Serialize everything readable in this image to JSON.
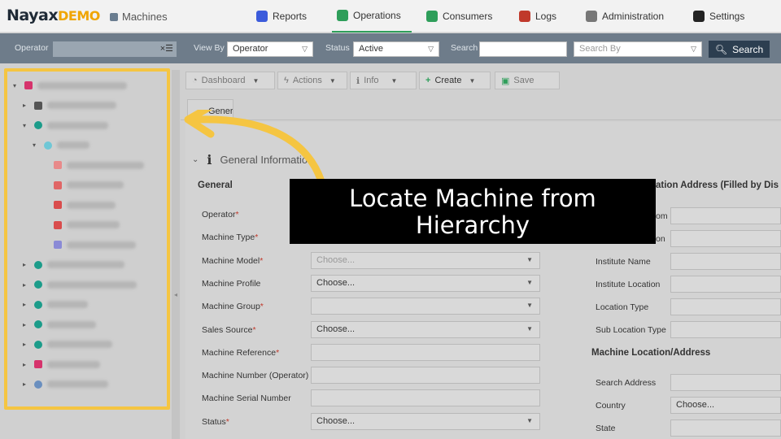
{
  "header": {
    "logo": {
      "brand": "Nayax",
      "suffix": "DEMO"
    },
    "module_title": "Machines",
    "nav": [
      {
        "label": "Reports",
        "icon": "chart-icon",
        "color": "#3b5bdb"
      },
      {
        "label": "Operations",
        "icon": "operations-icon",
        "color": "#2e9e5a",
        "active": true
      },
      {
        "label": "Consumers",
        "icon": "consumers-icon",
        "color": "#2e9e5a"
      },
      {
        "label": "Logs",
        "icon": "logs-icon",
        "color": "#c0392b"
      },
      {
        "label": "Administration",
        "icon": "administration-icon",
        "color": "#777777"
      },
      {
        "label": "Settings",
        "icon": "settings-icon",
        "color": "#222222"
      }
    ]
  },
  "filters": {
    "operator_label": "Operator",
    "view_by_label": "View By",
    "view_by_value": "Operator",
    "status_label": "Status",
    "status_value": "Active",
    "search_label": "Search",
    "search_value": "",
    "search_by_placeholder": "Search By",
    "search_button": "Search"
  },
  "toolbar": {
    "dashboard": "Dashboard",
    "actions": "Actions",
    "info": "Info",
    "create": "Create",
    "save": "Save"
  },
  "tabs": {
    "general": "General"
  },
  "section": {
    "title": "General Information"
  },
  "general": {
    "title": "General",
    "fields": [
      {
        "label": "Operator",
        "required": true,
        "value": ""
      },
      {
        "label": "Machine Type",
        "required": true,
        "value": ""
      },
      {
        "label": "Machine Model",
        "required": true,
        "value": "Choose...",
        "select": true,
        "placeholder": true
      },
      {
        "label": "Machine Profile",
        "required": false,
        "value": "Choose...",
        "select": true
      },
      {
        "label": "Machine Group",
        "required": true,
        "value": "",
        "select": true
      },
      {
        "label": "Sales Source",
        "required": true,
        "value": "Choose...",
        "select": true
      },
      {
        "label": "Machine Reference",
        "required": true,
        "value": ""
      },
      {
        "label": "Machine Number (Operator)",
        "required": false,
        "value": ""
      },
      {
        "label": "Machine Serial Number",
        "required": false,
        "value": ""
      },
      {
        "label": "Status",
        "required": true,
        "value": "Choose...",
        "select": true
      }
    ]
  },
  "location": {
    "title_partial": "ation Address (Filled by Dis",
    "fields_partial": [
      "om",
      "on"
    ],
    "fields": [
      "Institute Name",
      "Institute Location",
      "Location Type",
      "Sub Location Type"
    ],
    "address_title": "Machine Location/Address",
    "address_fields": [
      {
        "label": "Search Address",
        "value": ""
      },
      {
        "label": "Country",
        "value": "Choose..."
      },
      {
        "label": "State",
        "value": ""
      }
    ]
  },
  "tree": {
    "nodes": [
      {
        "indent": 0,
        "arrow": "▾",
        "icon": "hierarchy-icon",
        "color": "#d6336c",
        "w": 110
      },
      {
        "indent": 1,
        "arrow": "▸",
        "icon": "folder-icon",
        "color": "#555555",
        "w": 85
      },
      {
        "indent": 1,
        "arrow": "▾",
        "icon": "operator-icon",
        "color": "#1c9c8a",
        "w": 75
      },
      {
        "indent": 2,
        "arrow": "▾",
        "icon": "location-icon",
        "color": "#6fc7d6",
        "w": 40
      },
      {
        "indent": 3,
        "arrow": "",
        "icon": "machine-icon",
        "color": "#e88a8a",
        "w": 95
      },
      {
        "indent": 3,
        "arrow": "",
        "icon": "machine-icon",
        "color": "#e06666",
        "w": 70
      },
      {
        "indent": 3,
        "arrow": "",
        "icon": "machine-icon",
        "color": "#d94c4c",
        "w": 60
      },
      {
        "indent": 3,
        "arrow": "",
        "icon": "machine-icon",
        "color": "#d94c4c",
        "w": 65
      },
      {
        "indent": 3,
        "arrow": "",
        "icon": "machine-icon",
        "color": "#8a8ad6",
        "w": 85
      },
      {
        "indent": 1,
        "arrow": "▸",
        "icon": "operator-icon",
        "color": "#1c9c8a",
        "w": 95
      },
      {
        "indent": 1,
        "arrow": "▸",
        "icon": "operator-icon",
        "color": "#1c9c8a",
        "w": 110
      },
      {
        "indent": 1,
        "arrow": "▸",
        "icon": "operator-icon",
        "color": "#1c9c8a",
        "w": 50
      },
      {
        "indent": 1,
        "arrow": "▸",
        "icon": "operator-icon",
        "color": "#1c9c8a",
        "w": 60
      },
      {
        "indent": 1,
        "arrow": "▸",
        "icon": "operator-icon",
        "color": "#1c9c8a",
        "w": 80
      },
      {
        "indent": 1,
        "arrow": "▸",
        "icon": "hierarchy-icon",
        "color": "#d6336c",
        "w": 65
      },
      {
        "indent": 1,
        "arrow": "▸",
        "icon": "group-icon",
        "color": "#6a8fbf",
        "w": 75
      }
    ]
  },
  "overlay": {
    "line1": "Locate Machine from",
    "line2": "Hierarchy",
    "arrow_color": "#f5c542"
  }
}
